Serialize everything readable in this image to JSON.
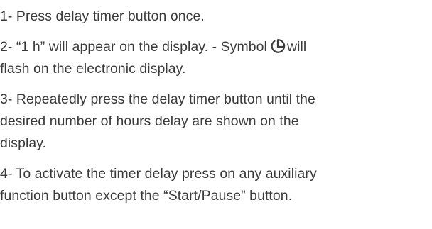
{
  "steps": [
    {
      "lines": [
        "1- Press delay timer button once."
      ]
    },
    {
      "line1_before": "2- “1 h” will appear on the display. - Symbol",
      "icon": "delay-timer-icon",
      "line1_after": "will",
      "line2": "flash on the electronic display."
    },
    {
      "lines": [
        "3- Repeatedly press the delay timer button until the",
        "desired number of hours delay are shown on the",
        "display."
      ]
    },
    {
      "lines": [
        "4- To activate the timer delay  press on any auxiliary",
        "function button except  the “Start/Pause” button."
      ]
    }
  ]
}
